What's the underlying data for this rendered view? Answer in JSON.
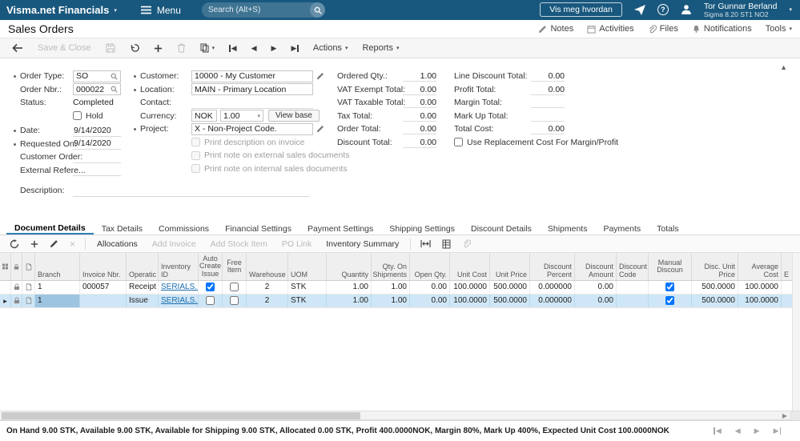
{
  "topbar": {
    "brand": "Visma.net Financials",
    "menu": "Menu",
    "search_placeholder": "Search (Alt+S)",
    "howto": "Vis meg hvordan",
    "user_name": "Tor Gunnar Berland",
    "user_org": "Sigma 8.20 ST1 NO2"
  },
  "titlebar": {
    "title": "Sales Orders",
    "notes": "Notes",
    "activities": "Activities",
    "files": "Files",
    "notifications": "Notifications",
    "tools": "Tools"
  },
  "toolbar": {
    "save_close": "Save & Close",
    "actions": "Actions",
    "reports": "Reports"
  },
  "form": {
    "order_type": {
      "label": "Order Type:",
      "value": "SO"
    },
    "order_nbr": {
      "label": "Order Nbr.:",
      "value": "000022"
    },
    "status": {
      "label": "Status:",
      "value": "Completed"
    },
    "hold_label": "Hold",
    "date": {
      "label": "Date:",
      "value": "9/14/2020"
    },
    "requested_on": {
      "label": "Requested On:",
      "value": "9/14/2020"
    },
    "customer_order": {
      "label": "Customer Order:",
      "value": ""
    },
    "external_ref": {
      "label": "External Refere...",
      "value": ""
    },
    "description": {
      "label": "Description:",
      "value": ""
    },
    "customer": {
      "label": "Customer:",
      "value": "10000 - My Customer"
    },
    "location": {
      "label": "Location:",
      "value": "MAIN - Primary Location"
    },
    "contact": {
      "label": "Contact:",
      "value": ""
    },
    "currency": {
      "label": "Currency:",
      "code": "NOK",
      "rate": "1.00",
      "view_base": "View base"
    },
    "project": {
      "label": "Project:",
      "value": "X - Non-Project Code."
    },
    "print_invoice_label": "Print description on invoice",
    "print_external_label": "Print note on external sales documents",
    "print_internal_label": "Print note on internal sales documents",
    "totals_a": [
      {
        "label": "Ordered Qty.:",
        "value": "1.00"
      },
      {
        "label": "VAT Exempt Total:",
        "value": "0.00"
      },
      {
        "label": "VAT Taxable Total:",
        "value": "0.00"
      },
      {
        "label": "Tax Total:",
        "value": "0.00"
      },
      {
        "label": "Order Total:",
        "value": "0.00"
      },
      {
        "label": "Discount Total:",
        "value": "0.00"
      }
    ],
    "totals_b": [
      {
        "label": "Line Discount Total:",
        "value": "0.00"
      },
      {
        "label": "Profit Total:",
        "value": "0.00"
      },
      {
        "label": "Margin Total:",
        "value": ""
      },
      {
        "label": "Mark Up Total:",
        "value": ""
      },
      {
        "label": "Total Cost:",
        "value": "0.00"
      }
    ],
    "replacement_label": "Use Replacement Cost For Margin/Profit"
  },
  "tabs": [
    "Document Details",
    "Tax Details",
    "Commissions",
    "Financial Settings",
    "Payment Settings",
    "Shipping Settings",
    "Discount Details",
    "Shipments",
    "Payments",
    "Totals"
  ],
  "gridbar": {
    "allocations": "Allocations",
    "add_invoice": "Add Invoice",
    "add_stock_item": "Add Stock Item",
    "po_link": "PO Link",
    "inventory_summary": "Inventory Summary"
  },
  "grid": {
    "columns": [
      "",
      "",
      "",
      "Branch",
      "Invoice Nbr.",
      "Operatic",
      "Inventory ID",
      "Auto Create Issue",
      "Free Item",
      "Warehouse",
      "UOM",
      "Quantity",
      "Qty. On Shipments",
      "Open Qty.",
      "Unit Cost",
      "Unit Price",
      "Discount Percent",
      "Discount Amount",
      "Discount Code",
      "Manual Discoun",
      "Disc. Unit Price",
      "Average Cost",
      "E"
    ],
    "rows": [
      {
        "branch": "1",
        "invoice_nbr": "000057",
        "operation": "Receipt",
        "inventory_id": "SERIALS...",
        "auto_create_issue": true,
        "free_item": false,
        "warehouse": "2",
        "uom": "STK",
        "quantity": "1.00",
        "qty_on_shipments": "1.00",
        "open_qty": "0.00",
        "unit_cost": "100.0000",
        "unit_price": "500.0000",
        "discount_percent": "0.000000",
        "discount_amount": "0.00",
        "discount_code": "",
        "manual_discount": true,
        "disc_unit_price": "500.0000",
        "average_cost": "100.0000"
      },
      {
        "branch": "1",
        "invoice_nbr": "",
        "operation": "Issue",
        "inventory_id": "SERIALS...",
        "auto_create_issue": false,
        "free_item": false,
        "warehouse": "2",
        "uom": "STK",
        "quantity": "1.00",
        "qty_on_shipments": "1.00",
        "open_qty": "0.00",
        "unit_cost": "100.0000",
        "unit_price": "500.0000",
        "discount_percent": "0.000000",
        "discount_amount": "0.00",
        "discount_code": "",
        "manual_discount": true,
        "disc_unit_price": "500.0000",
        "average_cost": "100.0000"
      }
    ]
  },
  "statusbar": {
    "summary": "On Hand 9.00 STK, Available 9.00 STK, Available for Shipping 9.00 STK, Allocated 0.00 STK, Profit 400.0000NOK, Margin 80%, Mark Up 400%, Expected Unit Cost 100.0000NOK"
  }
}
